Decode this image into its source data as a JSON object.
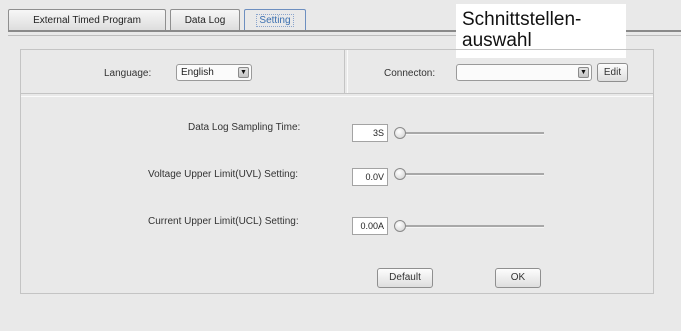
{
  "tabs": [
    {
      "label": "External Timed Program"
    },
    {
      "label": "Data Log"
    },
    {
      "label": "Setting"
    }
  ],
  "callout": {
    "line1": "Schnittstellen-",
    "line2": "auswahl"
  },
  "language": {
    "label": "Language:",
    "value": "English"
  },
  "connection": {
    "label": "Connecton:",
    "value": "",
    "edit_label": "Edit"
  },
  "settings": [
    {
      "label": "Data Log Sampling Time:",
      "value": "3S"
    },
    {
      "label": "Voltage Upper Limit(UVL) Setting:",
      "value": "0.0V"
    },
    {
      "label": "Current Upper Limit(UCL) Setting:",
      "value": "0.00A"
    }
  ],
  "buttons": {
    "default_label": "Default",
    "ok_label": "OK"
  },
  "icons": {
    "dropdown": "chevron-down-icon",
    "slider": "slider-thumb"
  }
}
